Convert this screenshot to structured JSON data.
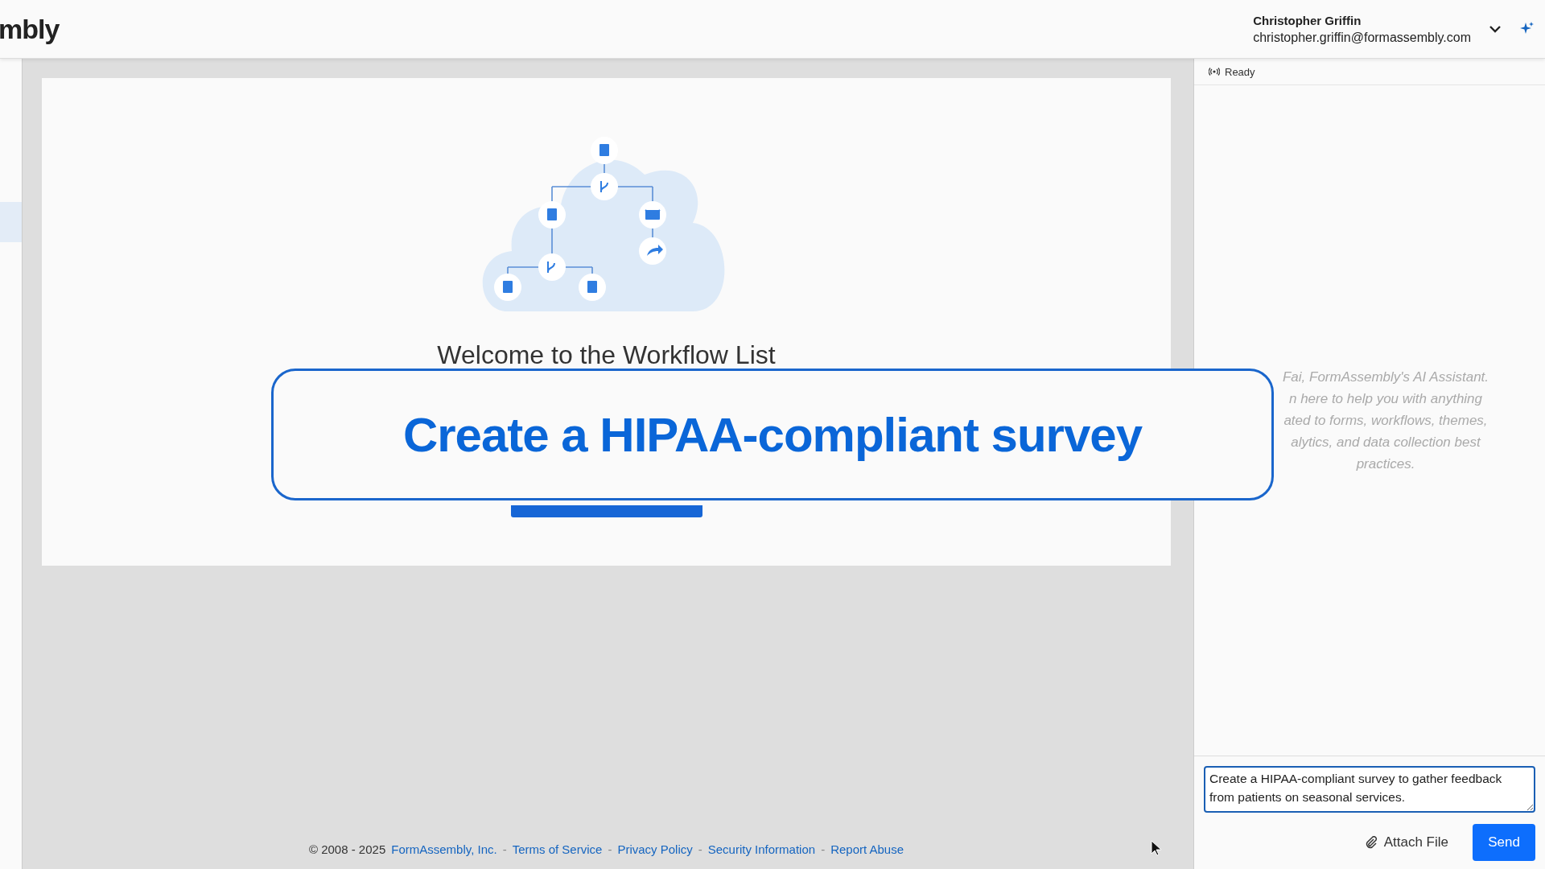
{
  "header": {
    "logo": "mbly",
    "user": {
      "name": "Christopher Griffin",
      "email": "christopher.griffin@formassembly.com"
    }
  },
  "workflow_page": {
    "heading": "Welcome to the Workflow List"
  },
  "caption": "Create a HIPAA-compliant survey",
  "footer": {
    "copyright": "© 2008 - 2025",
    "separator": "-",
    "links": [
      "FormAssembly, Inc.",
      "Terms of Service",
      "Privacy Policy",
      "Security Information",
      "Report Abuse"
    ]
  },
  "assistant": {
    "status": "Ready",
    "intro_lines": [
      "Fai, FormAssembly's AI Assistant.",
      "n here to help you with anything",
      "ated to forms, workflows, themes,",
      "alytics, and data collection best",
      "practices."
    ],
    "input": {
      "value": "Create a HIPAA-compliant survey to gather feedback from patients on seasonal services."
    },
    "attach": "Attach File",
    "send": "Send"
  }
}
